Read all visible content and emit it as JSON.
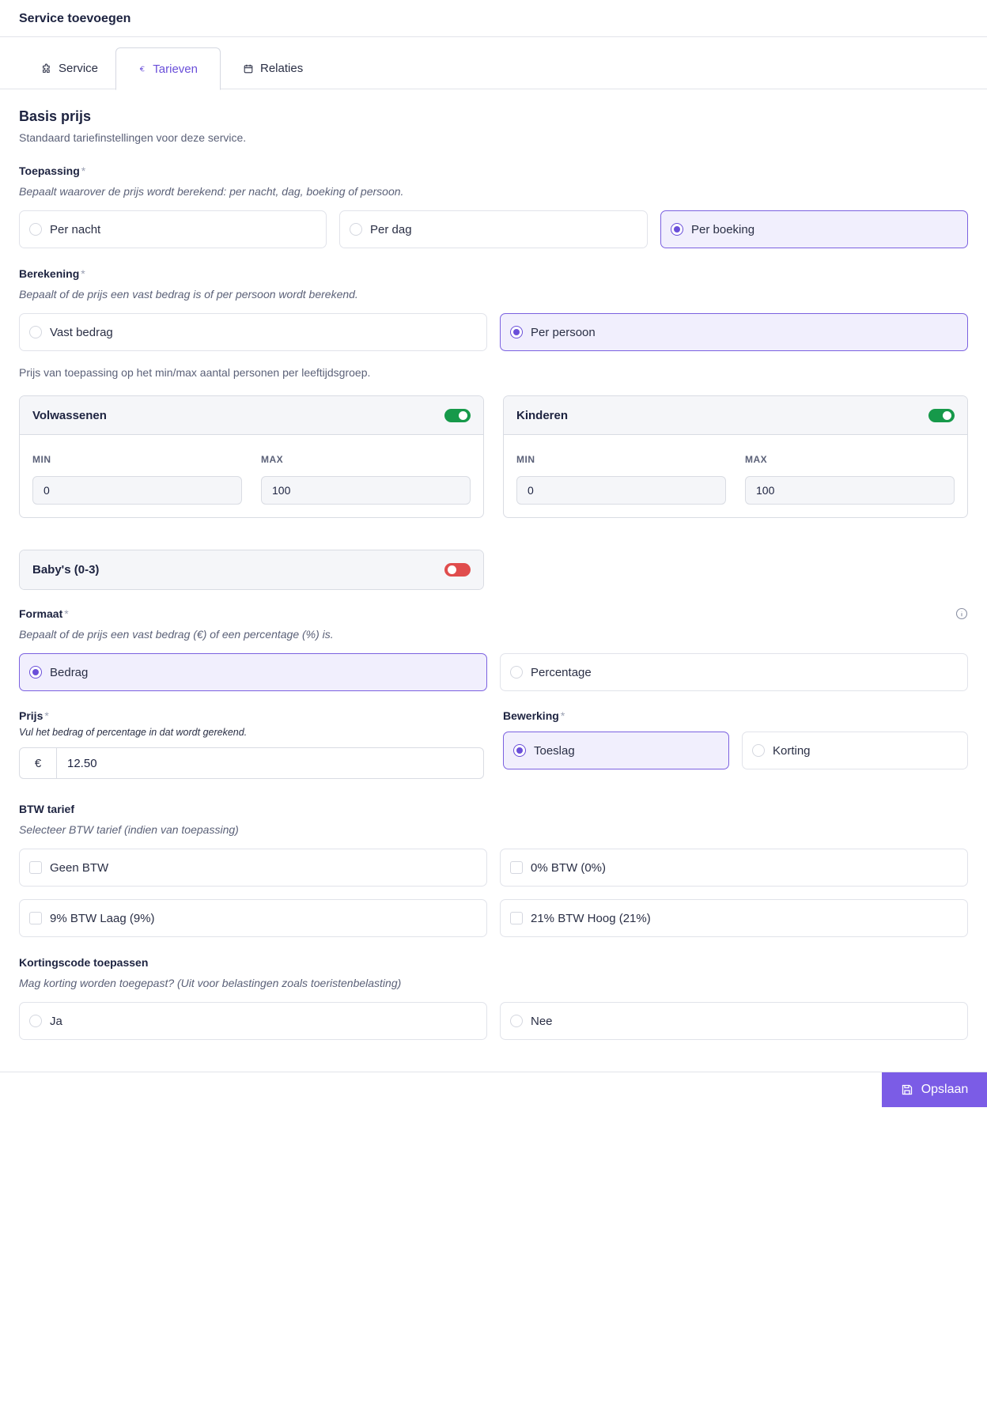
{
  "modal": {
    "title": "Service toevoegen"
  },
  "tabs": [
    {
      "label": "Service",
      "icon": "puzzle-icon"
    },
    {
      "label": "Tarieven",
      "icon": "euro-icon",
      "active": true
    },
    {
      "label": "Relaties",
      "icon": "calendar-icon"
    }
  ],
  "section": {
    "title": "Basis prijs",
    "subtitle": "Standaard tariefinstellingen voor deze service."
  },
  "toepassing": {
    "label": "Toepassing",
    "required": "*",
    "help": "Bepaalt waarover de prijs wordt berekend: per nacht, dag, boeking of persoon.",
    "options": [
      "Per nacht",
      "Per dag",
      "Per boeking"
    ],
    "selected": "Per boeking"
  },
  "berekening": {
    "label": "Berekening",
    "required": "*",
    "help": "Bepaalt of de prijs een vast bedrag is of per persoon wordt berekend.",
    "options": [
      "Vast bedrag",
      "Per persoon"
    ],
    "selected": "Per persoon"
  },
  "age_groups_note": "Prijs van toepassing op het min/max aantal personen per leeftijdsgroep.",
  "age_groups": [
    {
      "name": "Volwassenen",
      "enabled": true,
      "min_label": "MIN",
      "max_label": "MAX",
      "min": "0",
      "max": "100"
    },
    {
      "name": "Kinderen",
      "enabled": true,
      "min_label": "MIN",
      "max_label": "MAX",
      "min": "0",
      "max": "100"
    },
    {
      "name": "Baby's (0-3)",
      "enabled": false
    }
  ],
  "formaat": {
    "label": "Formaat",
    "required": "*",
    "help": "Bepaalt of de prijs een vast bedrag (€) of een percentage (%) is.",
    "options": [
      "Bedrag",
      "Percentage"
    ],
    "selected": "Bedrag"
  },
  "prijs": {
    "label": "Prijs",
    "required": "*",
    "help": "Vul het bedrag of percentage in dat wordt gerekend.",
    "currency": "€",
    "value": "12.50"
  },
  "bewerking": {
    "label": "Bewerking",
    "required": "*",
    "options": [
      "Toeslag",
      "Korting"
    ],
    "selected": "Toeslag"
  },
  "btw": {
    "label": "BTW tarief",
    "help": "Selecteer BTW tarief (indien van toepassing)",
    "options": [
      "Geen BTW",
      "0% BTW (0%)",
      "9% BTW Laag (9%)",
      "21% BTW Hoog (21%)"
    ]
  },
  "kortingscode": {
    "label": "Kortingscode toepassen",
    "help": "Mag korting worden toegepast? (Uit voor belastingen zoals toeristenbelasting)",
    "options": [
      "Ja",
      "Nee"
    ]
  },
  "footer": {
    "save_label": "Opslaan"
  },
  "colors": {
    "accent": "#7b5ce6",
    "toggle_on": "#16994a",
    "toggle_off": "#e04d4d"
  }
}
